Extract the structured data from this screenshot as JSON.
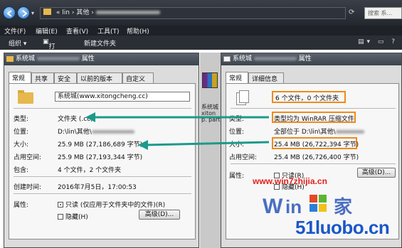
{
  "explorer": {
    "address_prefix": "«",
    "address_parts": [
      "lin",
      "其他"
    ],
    "address_sep": "›",
    "search_placeholder": "搜索 系...",
    "menu": [
      "文件(F)",
      "编辑(E)",
      "查看(V)",
      "工具(T)",
      "帮助(H)"
    ],
    "toolbar": [
      "组织 ▾",
      "打开",
      "新建文件夹"
    ]
  },
  "middle_file": {
    "lines": [
      "系统城",
      "xiton",
      "p. part"
    ]
  },
  "left_dialog": {
    "title_prefix": "系统城",
    "title_suffix": "属性",
    "tabs": [
      "常规",
      "共享",
      "安全",
      "以前的版本",
      "自定义"
    ],
    "name": "系统城(www.xitongcheng.cc)",
    "type_label": "类型:",
    "type_value": "文件夹 (.cc))",
    "location_label": "位置:",
    "location_value": "D:\\lin\\其他\\",
    "size_label": "大小:",
    "size_value": "25.9 MB (27,186,689 字节)",
    "disk_label": "占用空间:",
    "disk_value": "25.9 MB (27,193,344 字节)",
    "contains_label": "包含:",
    "contains_value": "4 个文件，2 个文件夹",
    "created_label": "创建时间:",
    "created_value": "2016年7月5日，17:00:53",
    "attr_label": "属性:",
    "readonly_label": "只读 (仅应用于文件夹中的文件)(R)",
    "hidden_label": "隐藏(H)",
    "advanced_button": "高级(D)..."
  },
  "right_dialog": {
    "title_prefix": "系统城",
    "title_suffix": "属性",
    "tabs": [
      "常规",
      "详细信息"
    ],
    "summary": "6 个文件，0 个文件夹",
    "type_label": "类型:",
    "type_value": "类型均为 WinRAR 压缩文件",
    "location_label": "位置:",
    "location_value": "全部位于 D:\\lin\\其他\\",
    "size_label": "大小:",
    "size_value": "25.4 MB (26,722,394 字节)",
    "disk_label": "占用空间:",
    "disk_value": "25.4 MB (26,726,400 字节)",
    "attr_label": "属性:",
    "readonly_label": "只读(R)",
    "hidden_label": "隐藏(H)",
    "advanced_button": "高级(D)..."
  },
  "watermark": {
    "site1": "www.win7zhijia.cn",
    "site2": "51luobo.cn"
  },
  "colors": {
    "highlight": "#f08a1c",
    "arrow": "#1b9a8a",
    "watermark_red": "#e0211b",
    "watermark_blue": "#1a57c9"
  }
}
